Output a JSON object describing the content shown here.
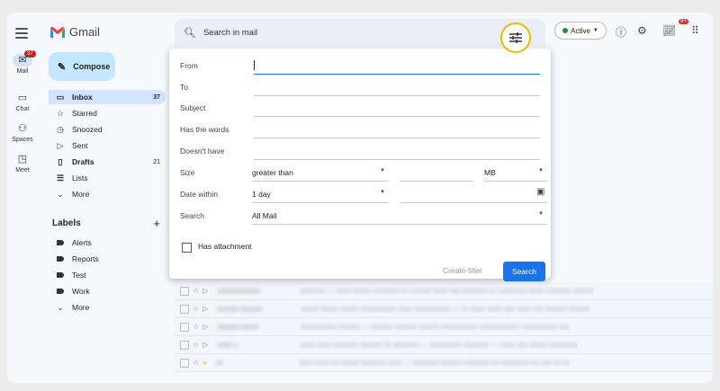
{
  "app": {
    "title": "Gmail"
  },
  "rail": {
    "mail": {
      "label": "Mail",
      "badge": "37"
    },
    "chat": {
      "label": "Chat"
    },
    "spaces": {
      "label": "Spaces"
    },
    "meet": {
      "label": "Meet"
    }
  },
  "compose": {
    "label": "Compose"
  },
  "nav": {
    "inbox": {
      "label": "Inbox",
      "count": "37"
    },
    "starred": {
      "label": "Starred"
    },
    "snoozed": {
      "label": "Snoozed"
    },
    "sent": {
      "label": "Sent"
    },
    "drafts": {
      "label": "Drafts",
      "count": "21"
    },
    "lists": {
      "label": "Lists"
    },
    "more": {
      "label": "More"
    }
  },
  "labels": {
    "title": "Labels",
    "add": "+",
    "items": [
      "Alerts",
      "Reports",
      "Test",
      "Work"
    ],
    "more": "More"
  },
  "search": {
    "placeholder": "Search in mail"
  },
  "header": {
    "status": "Active",
    "notify_badge": "9+"
  },
  "dialog": {
    "from": "From",
    "to": "To",
    "subject": "Subject",
    "has_words": "Has the words",
    "doesnt_have": "Doesn't have",
    "size": "Size",
    "size_op": "greater than",
    "size_unit": "MB",
    "date_within": "Date within",
    "date_value": "1 day",
    "search": "Search",
    "search_scope": "All Mail",
    "has_attachment": "Has attachment",
    "create_filter": "Create filter",
    "search_button": "Search"
  },
  "colors": {
    "accent": "#1a73e8",
    "compose_bg": "#c2e7ff",
    "active_nav": "#d3e3fd",
    "highlight_ring": "#f5b400"
  }
}
